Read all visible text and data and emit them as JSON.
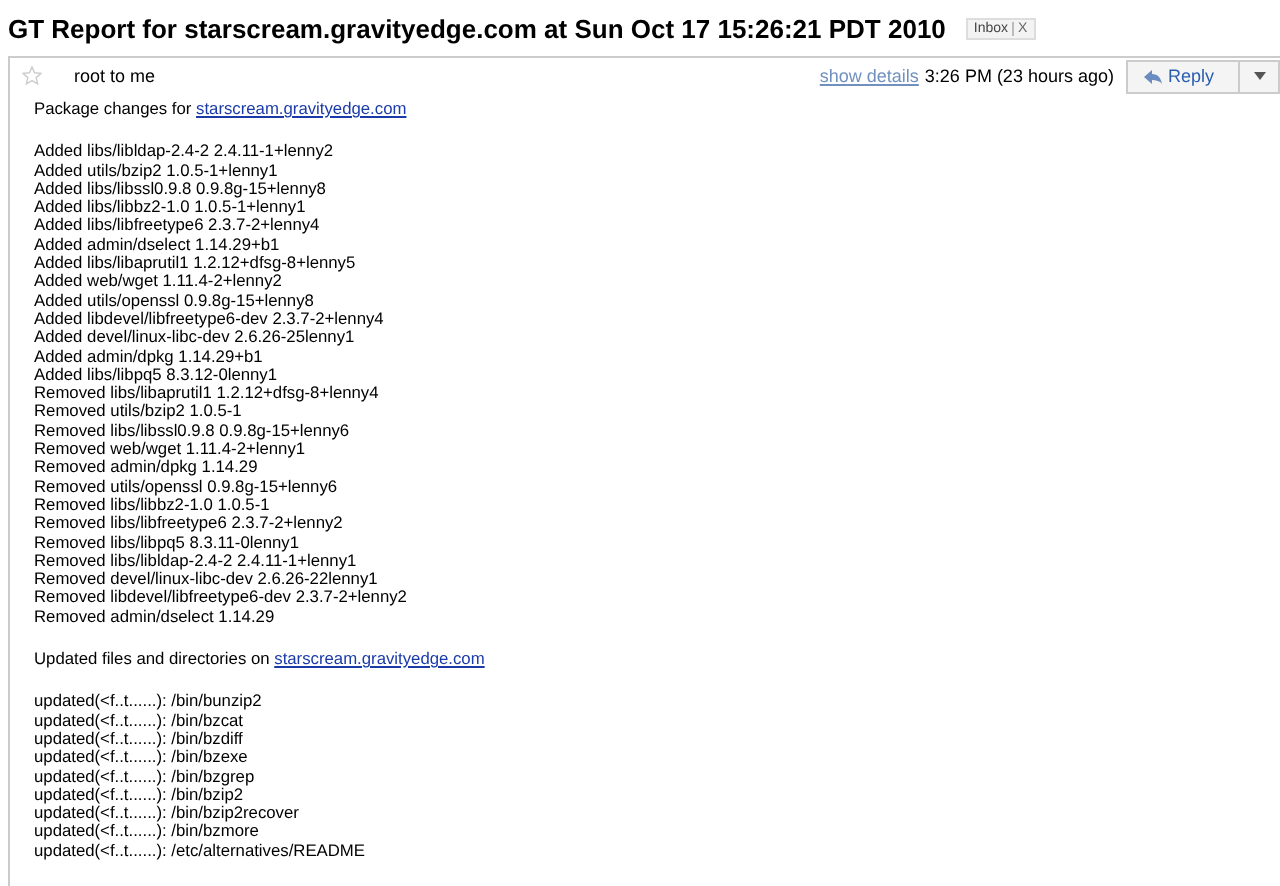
{
  "subject": "GT Report for starscream.gravityedge.com at Sun Oct 17 15:26:21 PDT 2010",
  "labels": [
    {
      "text": "Inbox",
      "remove": "X"
    }
  ],
  "message": {
    "starred": false,
    "sender": "root to me",
    "show_details": "show details",
    "time": "3:26 PM (23 hours ago)",
    "reply": "Reply",
    "intro": {
      "text": "Package changes for ",
      "link": "starscream.gravityedge.com"
    },
    "package_lines": [
      "Added libs/libldap-2.4-2 2.4.11-1+lenny2",
      "Added utils/bzip2 1.0.5-1+lenny1",
      "Added libs/libssl0.9.8 0.9.8g-15+lenny8",
      "Added libs/libbz2-1.0 1.0.5-1+lenny1",
      "Added libs/libfreetype6 2.3.7-2+lenny4",
      "Added admin/dselect 1.14.29+b1",
      "Added libs/libaprutil1 1.2.12+dfsg-8+lenny5",
      "Added web/wget 1.11.4-2+lenny2",
      "Added utils/openssl 0.9.8g-15+lenny8",
      "Added libdevel/libfreetype6-dev 2.3.7-2+lenny4",
      "Added devel/linux-libc-dev 2.6.26-25lenny1",
      "Added admin/dpkg 1.14.29+b1",
      "Added libs/libpq5 8.3.12-0lenny1",
      "Removed libs/libaprutil1 1.2.12+dfsg-8+lenny4",
      "Removed utils/bzip2 1.0.5-1",
      "Removed libs/libssl0.9.8 0.9.8g-15+lenny6",
      "Removed web/wget 1.11.4-2+lenny1",
      "Removed admin/dpkg 1.14.29",
      "Removed utils/openssl 0.9.8g-15+lenny6",
      "Removed libs/libbz2-1.0 1.0.5-1",
      "Removed libs/libfreetype6 2.3.7-2+lenny2",
      "Removed libs/libpq5 8.3.11-0lenny1",
      "Removed libs/libldap-2.4-2 2.4.11-1+lenny1",
      "Removed devel/linux-libc-dev 2.6.26-22lenny1",
      "Removed libdevel/libfreetype6-dev 2.3.7-2+lenny2",
      "Removed admin/dselect 1.14.29"
    ],
    "files_intro": {
      "text": "Updated files and directories on ",
      "link": "starscream.gravityedge.com"
    },
    "file_lines": [
      "updated(<f..t......): /bin/bunzip2",
      "updated(<f..t......): /bin/bzcat",
      "updated(<f..t......): /bin/bzdiff",
      "updated(<f..t......): /bin/bzexe",
      "updated(<f..t......): /bin/bzgrep",
      "updated(<f..t......): /bin/bzip2",
      "updated(<f..t......): /bin/bzip2recover",
      "updated(<f..t......): /bin/bzmore",
      "updated(<f..t......): /etc/alternatives/README"
    ]
  }
}
